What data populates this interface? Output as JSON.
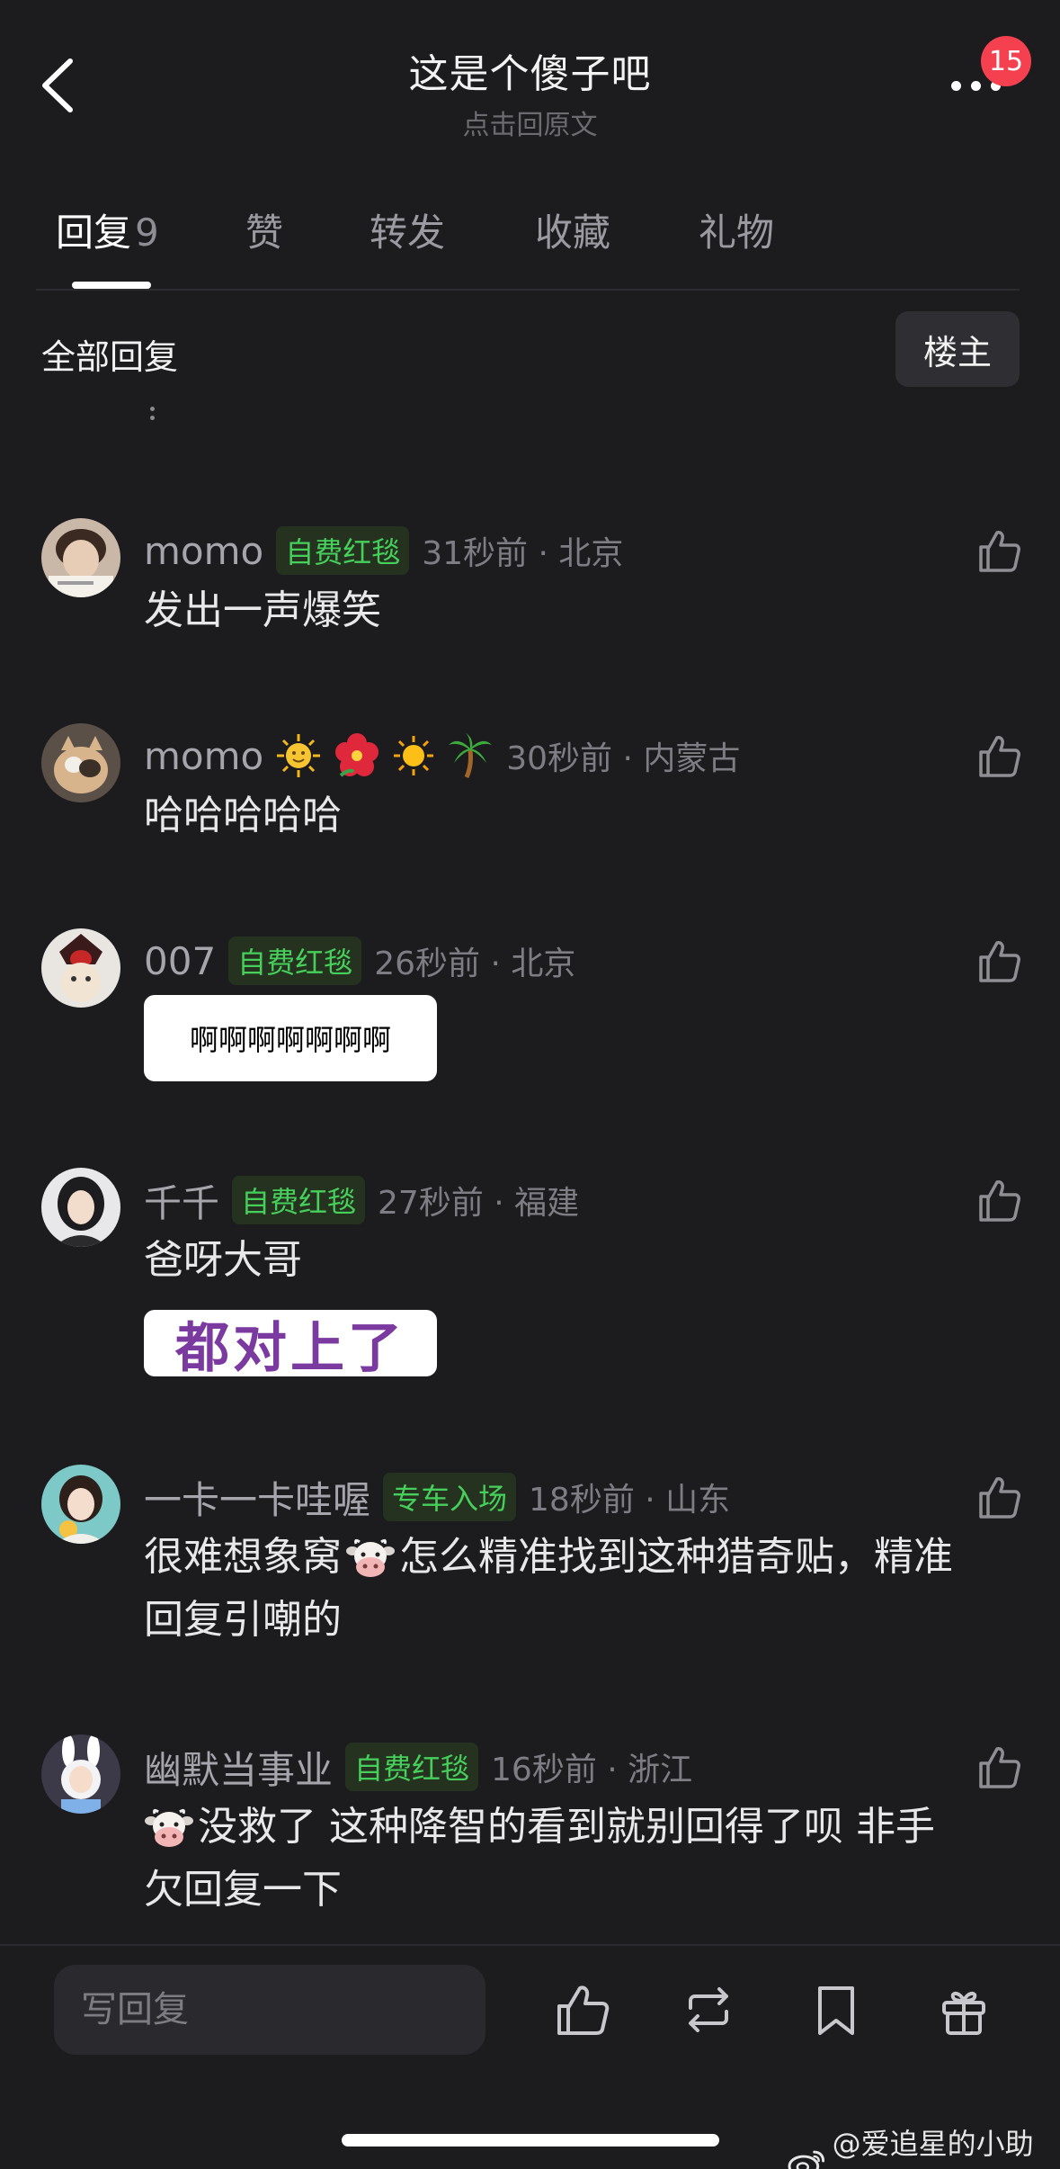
{
  "header": {
    "title": "这是个傻子吧",
    "subtitle": "点击回原文",
    "notification_count": "15"
  },
  "tabs": [
    {
      "label": "回复",
      "count": "9"
    },
    {
      "label": "赞"
    },
    {
      "label": "转发"
    },
    {
      "label": "收藏"
    },
    {
      "label": "礼物"
    }
  ],
  "section": {
    "title": "全部回复",
    "owner_button": "楼主"
  },
  "comments": [
    {
      "name": "momo",
      "tag": "自费红毯",
      "time": "31秒前 · 北京",
      "text": "发出一声爆笑"
    },
    {
      "name": "momo",
      "emojis": [
        "sun-with-face",
        "hibiscus",
        "sun",
        "palm-tree"
      ],
      "time": "30秒前 · 内蒙古",
      "text": "哈哈哈哈哈"
    },
    {
      "name": "007",
      "tag": "自费红毯",
      "time": "26秒前 · 北京",
      "sticker_text": "啊啊啊啊啊啊啊"
    },
    {
      "name": "千千",
      "tag": "自费红毯",
      "time": "27秒前 · 福建",
      "text": "爸呀大哥",
      "sticker_text": "都对上了"
    },
    {
      "name": "一卡一卡哇喔",
      "tag": "专车入场",
      "time": "18秒前 · 山东",
      "text_a": "很难想象窝",
      "text_b": "怎么精准找到这种猎奇贴，精准",
      "text_c": "回复引嘲的"
    },
    {
      "name": "幽默当事业",
      "tag": "自费红毯",
      "time": "16秒前 · 浙江",
      "text_a": "没救了 这种降智的看到就别回得了呗 非手",
      "text_b": "欠回复一下"
    }
  ],
  "bottom_bar": {
    "reply_placeholder": "写回复",
    "icons": [
      "thumb-up-icon",
      "repost-icon",
      "bookmark-icon",
      "gift-icon"
    ]
  },
  "watermark": "@爱追星的小助理"
}
